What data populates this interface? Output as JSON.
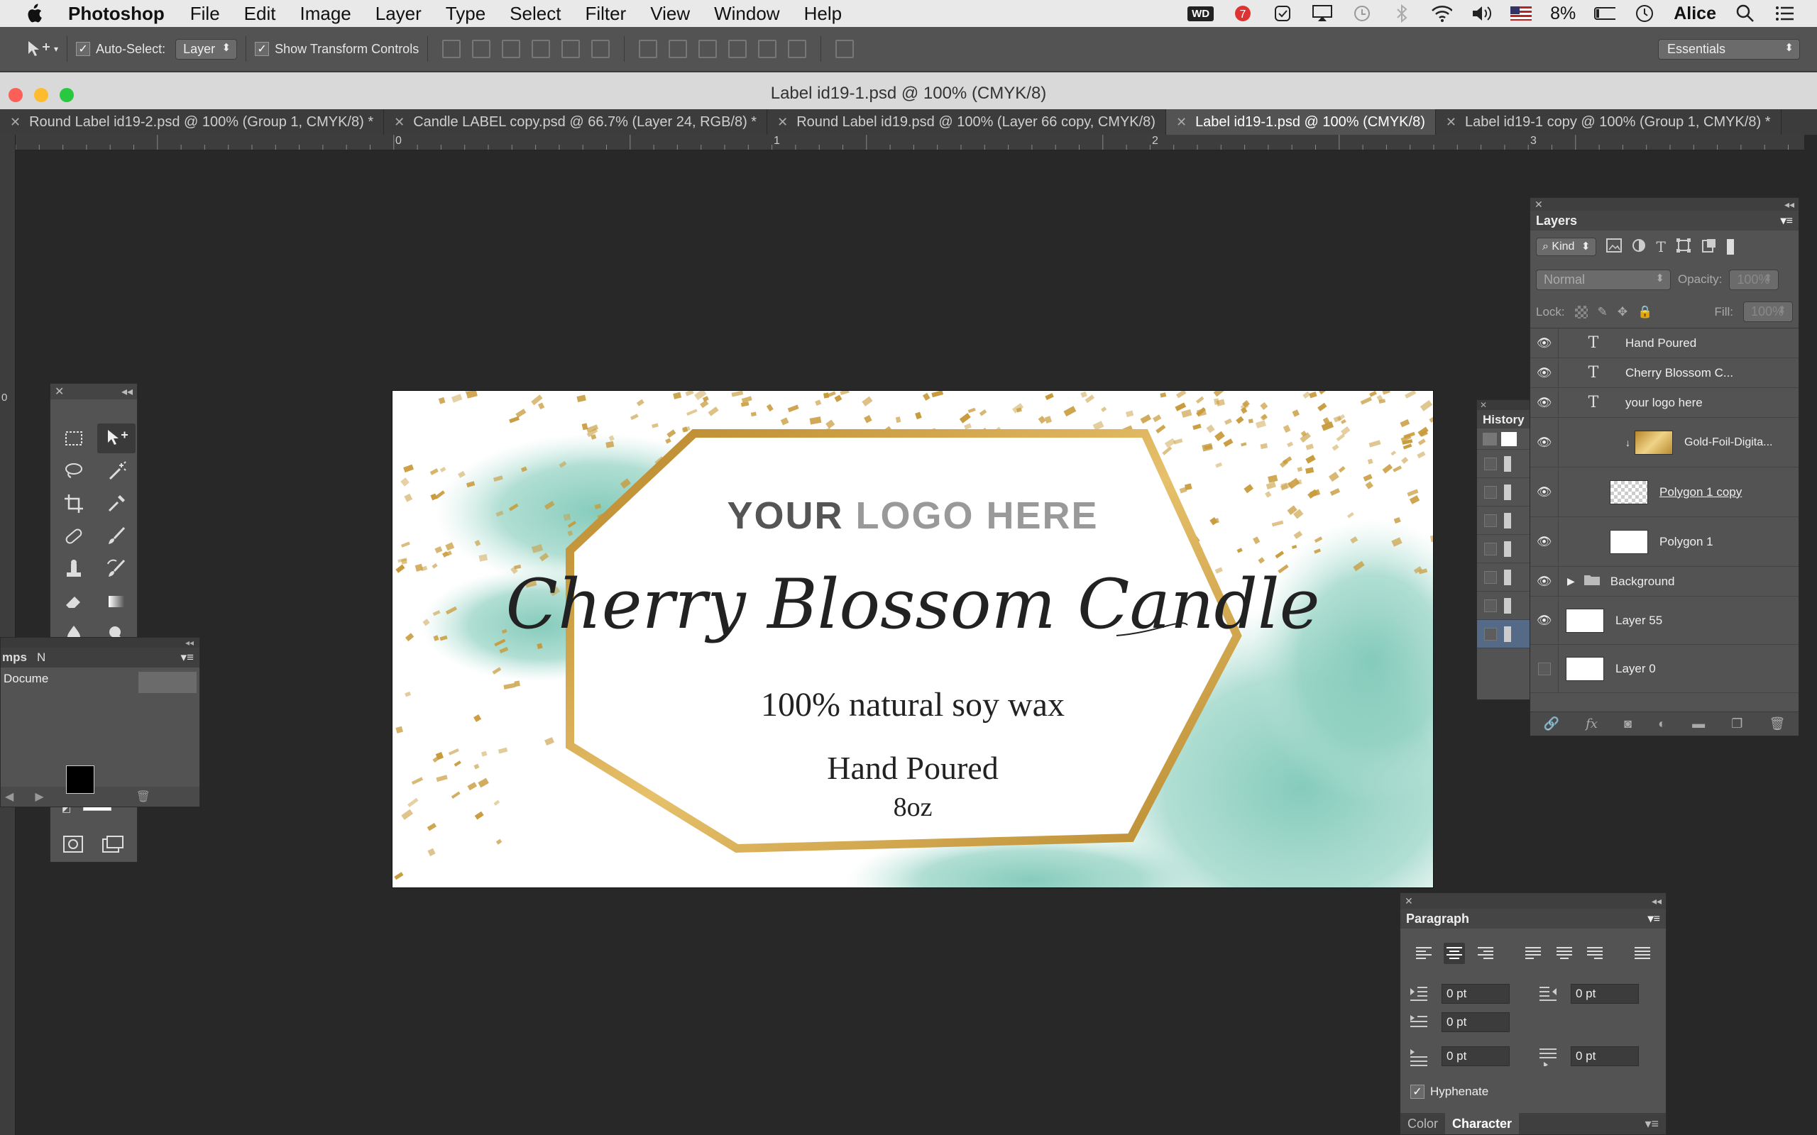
{
  "menubar": {
    "app": "Photoshop",
    "items": [
      "File",
      "Edit",
      "Image",
      "Layer",
      "Type",
      "Select",
      "Filter",
      "View",
      "Window",
      "Help"
    ],
    "battery": "8%",
    "user": "Alice",
    "wd_badge": "WD",
    "notif_count": "7"
  },
  "options": {
    "auto_select_label": "Auto-Select:",
    "auto_select_value": "Layer",
    "transform_label": "Show Transform Controls",
    "workspace": "Essentials"
  },
  "window": {
    "title": "Label id19-1.psd @ 100% (CMYK/8)"
  },
  "tabs": [
    "Round Label id19-2.psd @ 100% (Group 1, CMYK/8) *",
    "Candle LABEL copy.psd @ 66.7% (Layer 24, RGB/8) *",
    "Round Label id19.psd @ 100% (Layer 66 copy, CMYK/8)",
    "Label id19-1.psd @ 100% (CMYK/8)",
    "Label id19-1 copy @ 100% (Group 1, CMYK/8) *"
  ],
  "ruler": {
    "marks": [
      "0",
      "1",
      "2",
      "3"
    ],
    "left_mark": "0"
  },
  "label": {
    "logo_your": "YOUR",
    "logo_rest": "LOGO HERE",
    "title": "Cherry Blossom Candle",
    "wax": "100% natural soy wax",
    "hand": "Hand Poured",
    "oz": "8oz"
  },
  "colors": {
    "gold": "#c89a3a",
    "teal": "#7fc9b8"
  },
  "layers_panel": {
    "title": "Layers",
    "kind": "Kind",
    "blend": "Normal",
    "opacity_label": "Opacity:",
    "opacity_value": "100%",
    "lock_label": "Lock:",
    "fill_label": "Fill:",
    "fill_value": "100%",
    "rows": [
      {
        "name": "Hand Poured",
        "type": "text"
      },
      {
        "name": "Cherry Blossom C...",
        "type": "text"
      },
      {
        "name": "your logo here",
        "type": "text"
      },
      {
        "name": "Gold-Foil-Digita...",
        "type": "image"
      },
      {
        "name": "Polygon 1 copy",
        "type": "shape"
      },
      {
        "name": "Polygon 1",
        "type": "shape"
      },
      {
        "name": "Background",
        "type": "group"
      },
      {
        "name": "Layer 55",
        "type": "pixel"
      },
      {
        "name": "Layer 0",
        "type": "pixel"
      }
    ]
  },
  "history_panel": {
    "title": "History"
  },
  "left_panel": {
    "tab1": "mps",
    "tab2": "N",
    "row": "Docume"
  },
  "paragraph_panel": {
    "title": "Paragraph",
    "indent_left": "0 pt",
    "indent_right": "0 pt",
    "indent_first": "0 pt",
    "space_before": "0 pt",
    "space_after": "0 pt",
    "hyphenate": "Hyphenate",
    "tab_color": "Color",
    "tab_character": "Character"
  }
}
